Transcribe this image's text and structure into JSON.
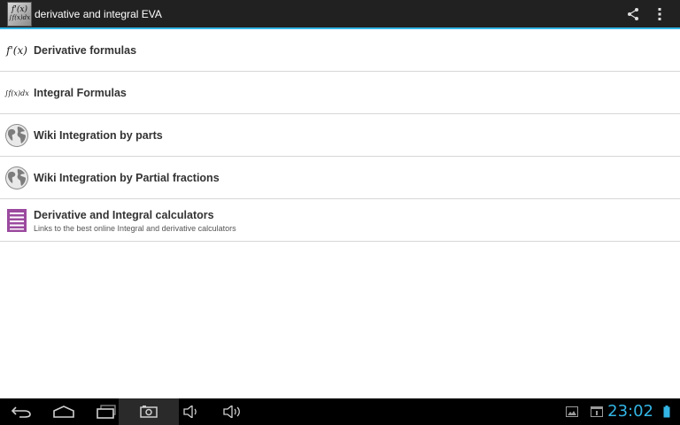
{
  "app": {
    "title": "derivative and integral EVA",
    "icon": "app-formula-icon",
    "icon_top": "f'(x)",
    "icon_bottom": "∫f(x)dx"
  },
  "action_bar": {
    "share": "share-icon",
    "overflow": "overflow-menu-icon"
  },
  "items": [
    {
      "title": "Derivative formulas",
      "subtitle": "",
      "icon": "derivative-formula-icon",
      "icon_text": "f'(x)"
    },
    {
      "title": "Integral Formulas",
      "subtitle": "",
      "icon": "integral-formula-icon",
      "icon_text": "∫f(x)dx"
    },
    {
      "title": "Wiki Integration by parts",
      "subtitle": "",
      "icon": "globe-icon"
    },
    {
      "title": "Wiki Integration by Partial fractions",
      "subtitle": "",
      "icon": "globe-icon"
    },
    {
      "title": "Derivative and Integral calculators",
      "subtitle": "Links to the best online Integral and derivative calculators",
      "icon": "document-list-icon"
    }
  ],
  "nav_bar": {
    "buttons": [
      "back-icon",
      "home-icon",
      "recent-apps-icon",
      "screenshot-icon",
      "volume-down-icon",
      "volume-up-icon"
    ],
    "clock": "23:02"
  },
  "colors": {
    "accent": "#33b5e5",
    "action_bar": "#212121",
    "nav_bar": "#000000",
    "doc_icon": "#9b4a9f"
  }
}
